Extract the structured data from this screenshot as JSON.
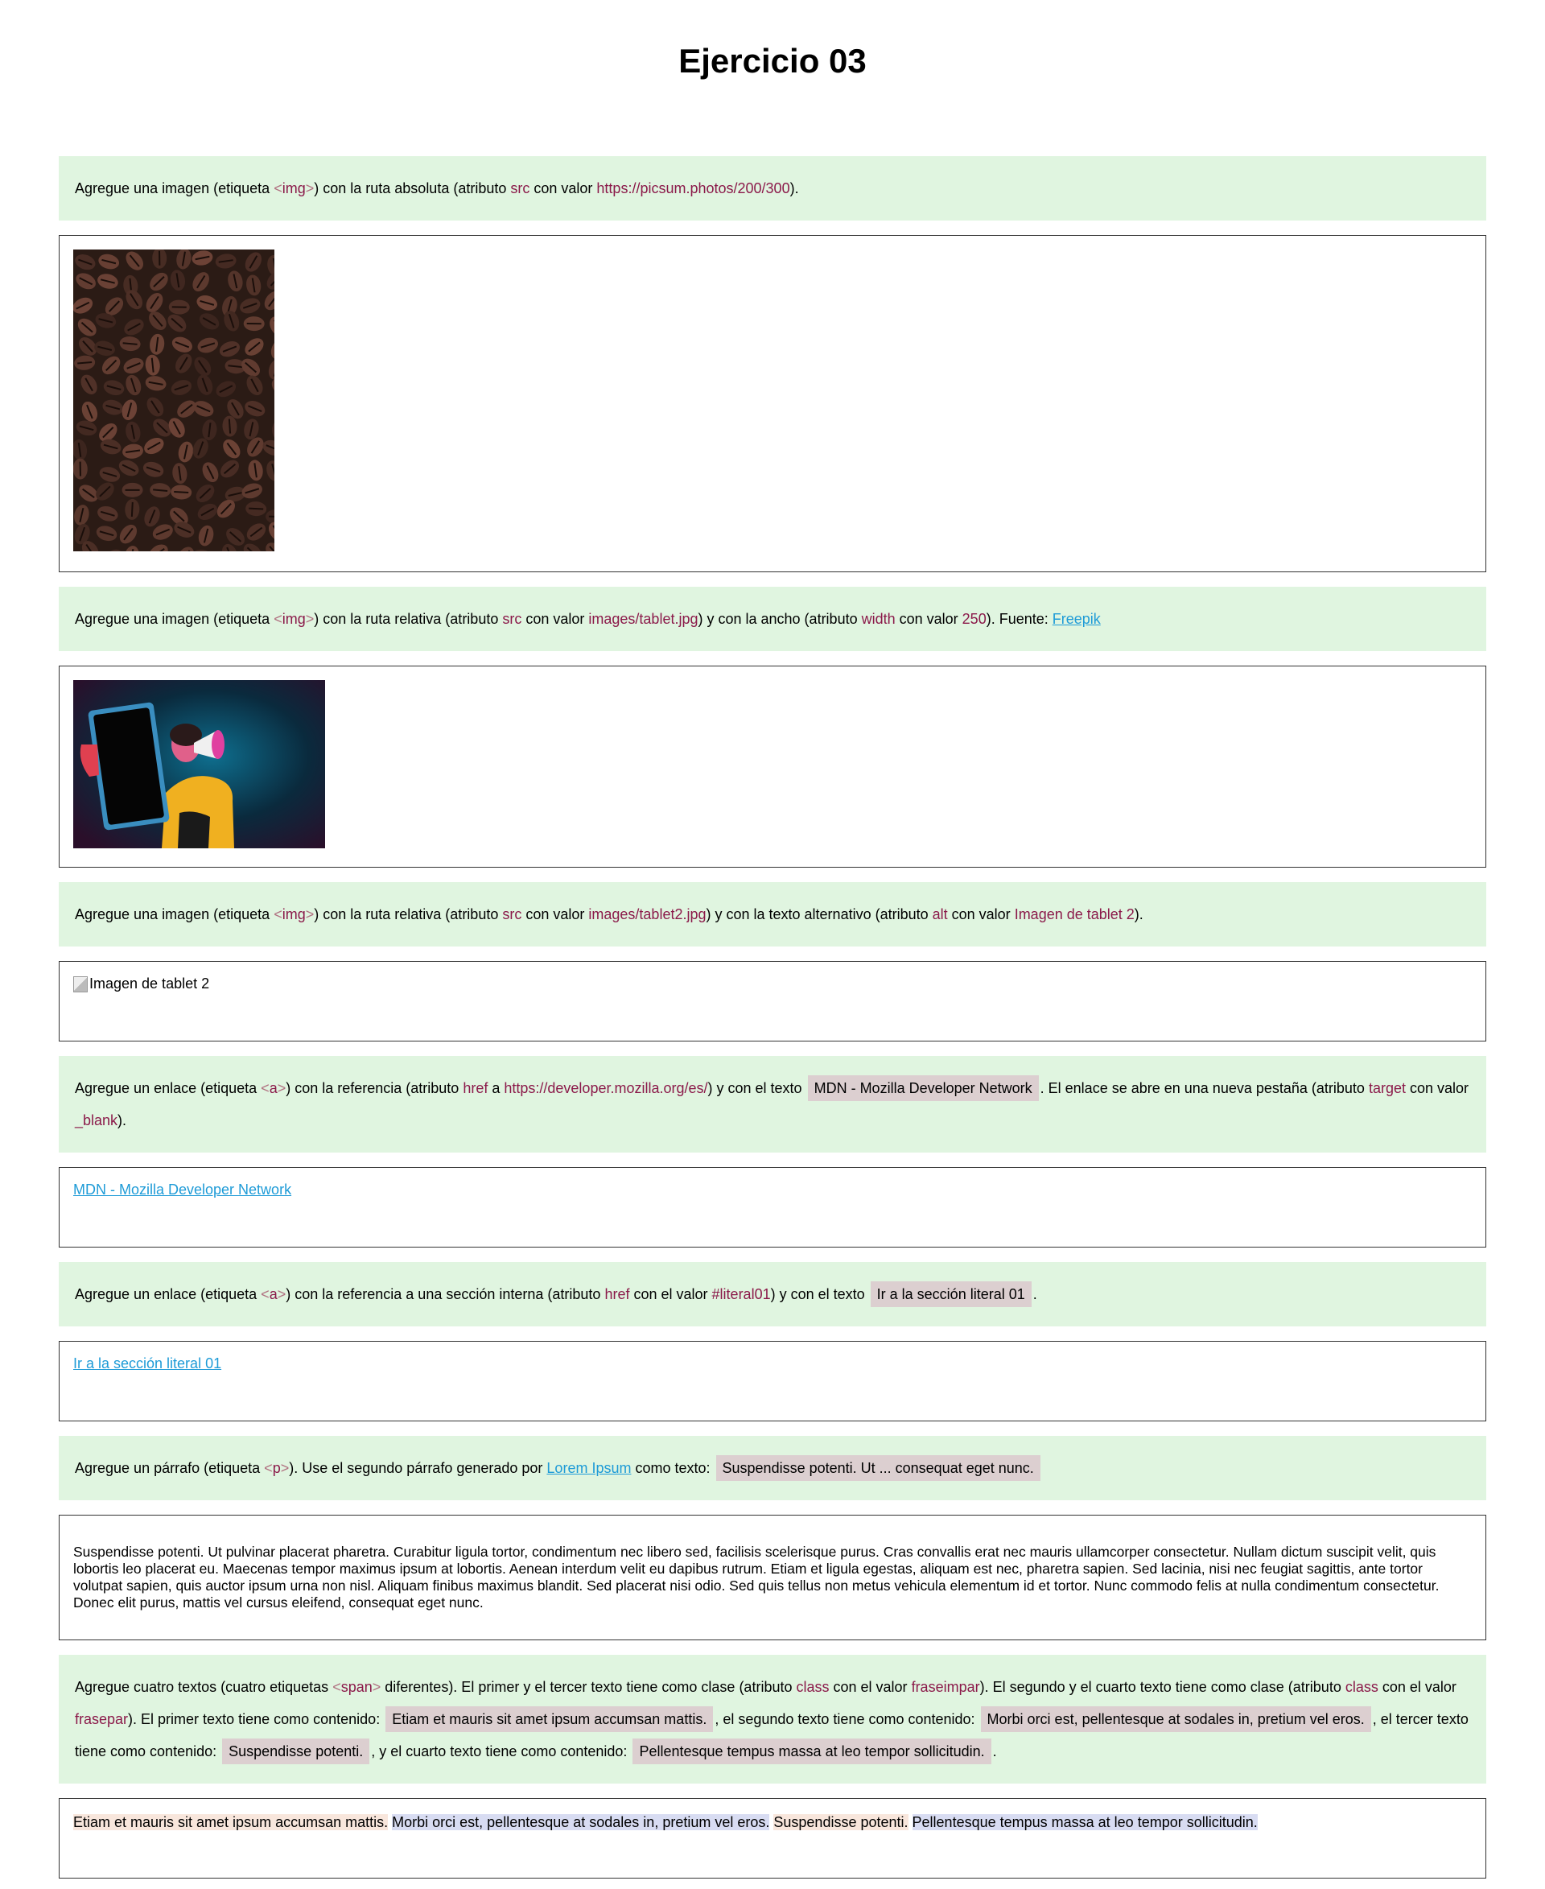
{
  "title": "Ejercicio 03",
  "task1": {
    "t1": "Agregue una imagen (etiqueta ",
    "tag_open": "<",
    "tag": "img",
    "tag_close": ">",
    "t2": ") con la ruta absoluta (atributo ",
    "attr": "src",
    "t3": " con valor ",
    "value": "https://picsum.photos/200/300",
    "t4": ")."
  },
  "image1": {
    "description": "coffee-beans-photo"
  },
  "task2": {
    "t1": "Agregue una imagen (etiqueta ",
    "tag_open": "<",
    "tag": "img",
    "tag_close": ">",
    "t2": ") con la ruta relativa (atributo ",
    "attr1": "src",
    "t3": " con valor ",
    "value1": "images/tablet.jpg",
    "t4": ") y con la ancho (atributo ",
    "attr2": "width",
    "t5": " con valor ",
    "value2": "250",
    "t6": "). Fuente: ",
    "link": "Freepik"
  },
  "task3": {
    "t1": "Agregue una imagen (etiqueta ",
    "tag_open": "<",
    "tag": "img",
    "tag_close": ">",
    "t2": ") con la ruta relativa (atributo ",
    "attr1": "src",
    "t3": " con valor ",
    "value1": "images/tablet2.jpg",
    "t4": ") y con la texto alternativo (atributo ",
    "attr2": "alt",
    "t5": " con valor ",
    "value2": "Imagen de tablet 2",
    "t6": ")."
  },
  "broken_image_alt": "Imagen de tablet 2",
  "task4": {
    "t1": "Agregue un enlace (etiqueta ",
    "tag_open": "<",
    "tag": "a",
    "tag_close": ">",
    "t2": ") con la referencia (atributo ",
    "attr1": "href",
    "t3": " a ",
    "value1": "https://developer.mozilla.org/es/",
    "t4": ") y con el texto ",
    "quote": "MDN - Mozilla Developer Network",
    "t5": ". El enlace se abre en una nueva pestaña (atributo ",
    "attr2": "target",
    "t6": " con valor ",
    "value2": "_blank",
    "t7": ")."
  },
  "link_mdn": "MDN - Mozilla Developer Network",
  "task5": {
    "t1": "Agregue un enlace (etiqueta ",
    "tag_open": "<",
    "tag": "a",
    "tag_close": ">",
    "t2": ") con la referencia a una sección interna (atributo ",
    "attr": "href",
    "t3": " con el valor ",
    "value": "#literal01",
    "t4": ") y con el texto ",
    "quote": "Ir a la sección literal 01",
    "t5": "."
  },
  "link_section": "Ir a la sección literal 01",
  "task6": {
    "t1": "Agregue un párrafo (etiqueta ",
    "tag_open": "<",
    "tag": "p",
    "tag_close": ">",
    "t2": "). Use el segundo párrafo generado por ",
    "link": "Lorem Ipsum",
    "t3": " como texto: ",
    "quote": "Suspendisse potenti. Ut ... consequat eget nunc."
  },
  "paragraph": "Suspendisse potenti. Ut pulvinar placerat pharetra. Curabitur ligula tortor, condimentum nec libero sed, facilisis scelerisque purus. Cras convallis erat nec mauris ullamcorper consectetur. Nullam dictum suscipit velit, quis lobortis leo placerat eu. Maecenas tempor maximus ipsum at lobortis. Aenean interdum velit eu dapibus rutrum. Etiam et ligula egestas, aliquam est nec, pharetra sapien. Sed lacinia, nisi nec feugiat sagittis, ante tortor volutpat sapien, quis auctor ipsum urna non nisl. Aliquam finibus maximus blandit. Sed placerat nisi odio. Sed quis tellus non metus vehicula elementum id et tortor. Nunc commodo felis at nulla condimentum consectetur. Donec elit purus, mattis vel cursus eleifend, consequat eget nunc.",
  "task7": {
    "t1": "Agregue cuatro textos (cuatro etiquetas ",
    "tag_open": "<",
    "tag": "span",
    "tag_close": ">",
    "t2": " diferentes). El primer y el tercer texto tiene como clase (atributo ",
    "attr1": "class",
    "t3": " con el valor ",
    "value1": "fraseimpar",
    "t4": "). El segundo y el cuarto texto tiene como clase (atributo ",
    "attr2": "class",
    "t5": " con el valor ",
    "value2": "frasepar",
    "t6": "). El primer texto tiene como contenido: ",
    "q1": "Etiam et mauris sit amet ipsum accumsan mattis.",
    "t7": ", el segundo texto tiene como contenido: ",
    "q2": "Morbi orci est, pellentesque at sodales in, pretium vel eros.",
    "t8": ", el tercer texto tiene como contenido: ",
    "q3": "Suspendisse potenti.",
    "t9": ", y el cuarto texto tiene como contenido: ",
    "q4": "Pellentesque tempus massa at leo tempor sollicitudin.",
    "t10": "."
  },
  "spans": {
    "s1": "Etiam et mauris sit amet ipsum accumsan mattis.",
    "s2": "Morbi orci est, pellentesque at sodales in, pretium vel eros.",
    "s3": "Suspendisse potenti.",
    "s4": "Pellentesque tempus massa at leo tempor sollicitudin."
  },
  "colors": {
    "task_bg": "#e0f5e0",
    "code": "#8b1a4a",
    "link": "#1e9bd7",
    "quote_bg": "#dccfd0",
    "fraseimpar_bg": "#f8e6dc",
    "frasepar_bg": "#d8dcf2"
  }
}
